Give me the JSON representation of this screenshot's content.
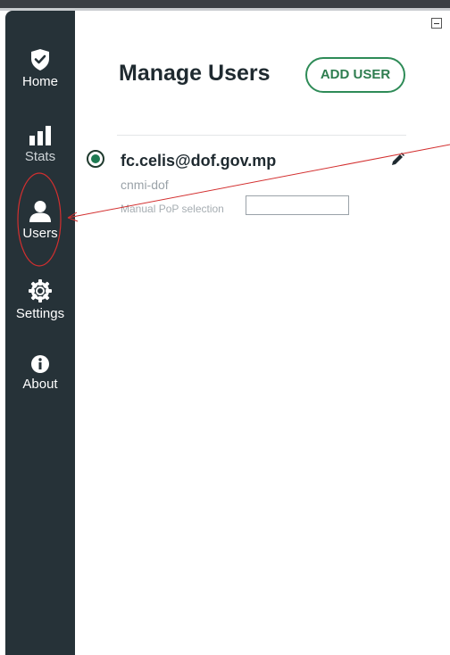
{
  "sidebar": {
    "items": [
      {
        "label": "Home",
        "icon": "shield-check-icon"
      },
      {
        "label": "Stats",
        "icon": "bar-chart-icon"
      },
      {
        "label": "Users",
        "icon": "user-icon"
      },
      {
        "label": "Settings",
        "icon": "gear-icon"
      },
      {
        "label": "About",
        "icon": "info-icon"
      }
    ]
  },
  "main": {
    "title": "Manage Users",
    "add_user_label": "ADD USER"
  },
  "users": [
    {
      "email": "fc.celis@dof.gov.mp",
      "org": "cnmi-dof",
      "pop_label": "Manual PoP selection",
      "pop_value": ""
    }
  ],
  "colors": {
    "sidebar_bg": "#263238",
    "accent": "#2e8b57",
    "annotation": "#d32f2f"
  }
}
